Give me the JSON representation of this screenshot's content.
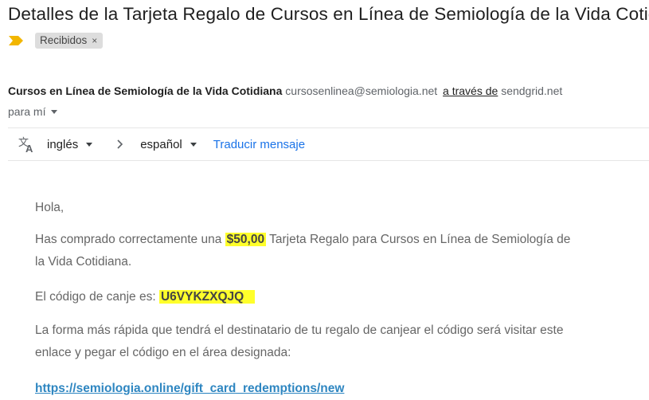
{
  "email": {
    "subject": "Detalles de la Tarjeta Regalo de Cursos en Línea de Semiología de la Vida Cotidiana",
    "label_chip": "Recibidos",
    "label_close_glyph": "×",
    "importance_color": "#f2b600",
    "sender": {
      "name": "Cursos en Línea de Semiología de la Vida Cotidiana",
      "email": "cursosenlinea@semiologia.net",
      "via_text": "a través de",
      "via_domain": "sendgrid.net"
    },
    "recipient_text": "para mí"
  },
  "translate_bar": {
    "icon": "translate-icon",
    "source_language": "inglés",
    "target_language": "español",
    "action": "Traducir mensaje"
  },
  "message": {
    "greeting": "Hola,",
    "p1_before": "Has comprado correctamente una",
    "amount": "$50,00",
    "p1_after": "Tarjeta Regalo para Cursos en Línea de Semiología de la Vida Cotidiana.",
    "code_label": "El código de canje es:",
    "code": "U6VYKZXQJQ",
    "p3": "La forma más rápida que tendrá el destinatario de tu regalo de canjear el código será visitar este enlace y pegar el código en el área designada:",
    "redeem_url": "https://semiologia.online/gift_card_redemptions/new"
  },
  "colors": {
    "highlight": "#ffff2b",
    "link": "#2e86c1",
    "translate_link": "#1a73e8"
  }
}
